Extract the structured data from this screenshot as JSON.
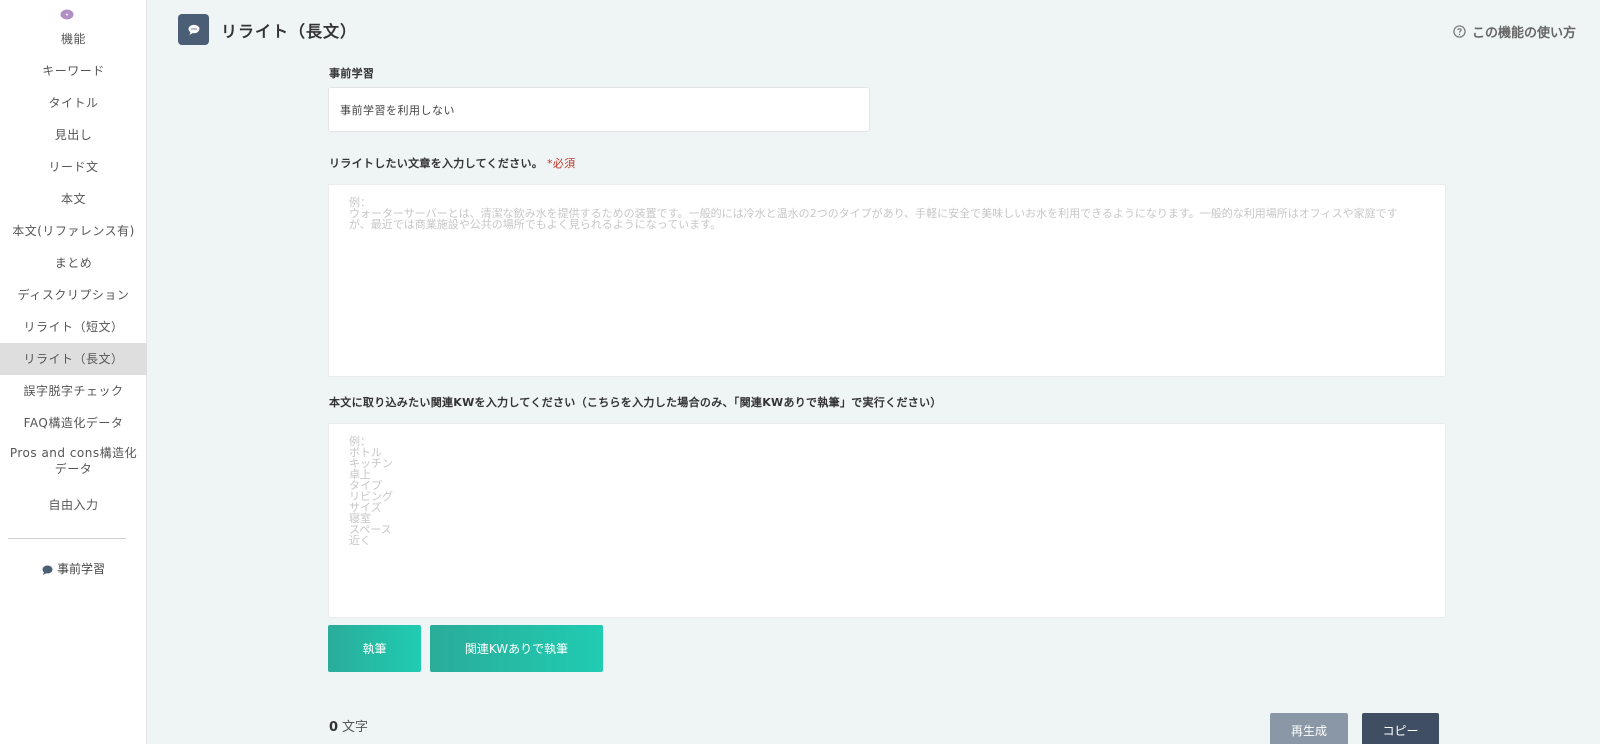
{
  "sidebar": {
    "items": [
      {
        "label": "機能",
        "active": false
      },
      {
        "label": "キーワード",
        "active": false
      },
      {
        "label": "タイトル",
        "active": false
      },
      {
        "label": "見出し",
        "active": false
      },
      {
        "label": "リード文",
        "active": false
      },
      {
        "label": "本文",
        "active": false
      },
      {
        "label": "本文(リファレンス有)",
        "active": false
      },
      {
        "label": "まとめ",
        "active": false
      },
      {
        "label": "ディスクリプション",
        "active": false
      },
      {
        "label": "リライト（短文）",
        "active": false
      },
      {
        "label": "リライト（長文）",
        "active": true
      },
      {
        "label": "誤字脱字チェック",
        "active": false
      },
      {
        "label": "FAQ構造化データ",
        "active": false
      },
      {
        "label": "Pros and cons構造化データ",
        "active": false
      },
      {
        "label": "自由入力",
        "active": false
      }
    ],
    "prelearn_label": "事前学習"
  },
  "header": {
    "title": "リライト（長文）",
    "howto_label": "この機能の使い方"
  },
  "form": {
    "prelearn_label": "事前学習",
    "prelearn_value": "事前学習を利用しない",
    "text_label": "リライトしたい文章を入力してください。",
    "required_label": "*必須",
    "text_placeholder": "例：\nウォーターサーバーとは、清潔な飲み水を提供するための装置です。一般的には冷水と温水の2つのタイプがあり、手軽に安全で美味しいお水を利用できるようになります。一般的な利用場所はオフィスや家庭です\nが、最近では商業施設や公共の場所でもよく見られるようになっています。",
    "kw_label": "本文に取り込みたい関連KWを入力してください（こちらを入力した場合のみ、「関連KWありで執筆」で実行ください）",
    "kw_placeholder": "例：\nボトル\nキッチン\n卓上\nタイプ\nリビング\nサイズ\n寝室\nスペース\n近く",
    "write_button": "執筆",
    "write_kw_button": "関連KWありで執筆"
  },
  "footer": {
    "count_value": "0",
    "count_unit": "文字",
    "regenerate_button": "再生成",
    "copy_button": "コピー"
  },
  "colors": {
    "accent_green": "#20ccb2",
    "dark_slate": "#3f4e63",
    "required_red": "#c0392b",
    "sidebar_icon": "#b18fc4"
  },
  "icons": {
    "sidebar_top": "speech-bubble-icon",
    "page": "speech-bubble-icon",
    "howto": "question-circle-icon",
    "prelearn": "speech-bubble-icon"
  }
}
